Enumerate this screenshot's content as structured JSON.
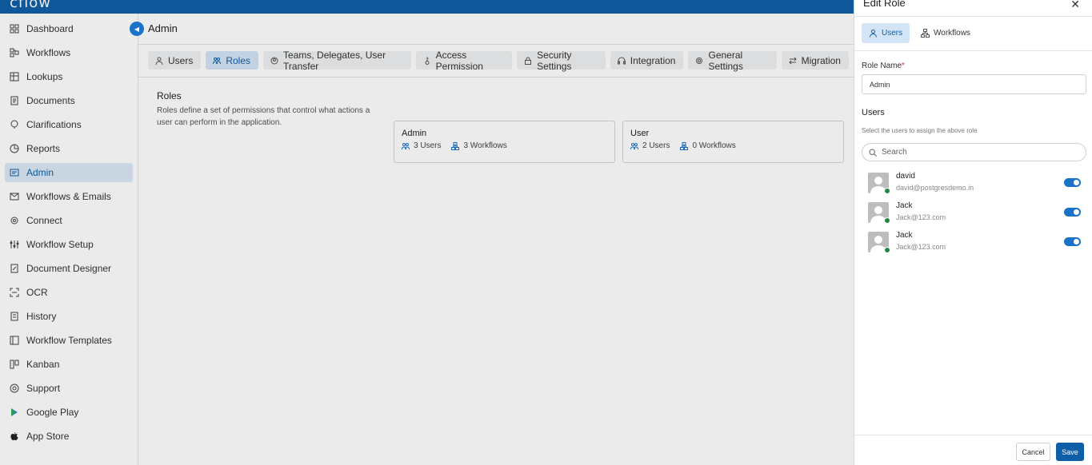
{
  "app": {
    "logo": "cflow"
  },
  "sidebar": {
    "items": [
      {
        "label": "Dashboard",
        "icon": "dashboard-icon"
      },
      {
        "label": "Workflows",
        "icon": "workflows-icon"
      },
      {
        "label": "Lookups",
        "icon": "lookups-icon"
      },
      {
        "label": "Documents",
        "icon": "documents-icon"
      },
      {
        "label": "Clarifications",
        "icon": "clarifications-icon"
      },
      {
        "label": "Reports",
        "icon": "reports-icon"
      },
      {
        "label": "Admin",
        "icon": "admin-icon",
        "active": true
      },
      {
        "label": "Workflows & Emails",
        "icon": "mail-icon"
      },
      {
        "label": "Connect",
        "icon": "connect-icon"
      },
      {
        "label": "Workflow Setup",
        "icon": "setup-icon"
      },
      {
        "label": "Document Designer",
        "icon": "designer-icon"
      },
      {
        "label": "OCR",
        "icon": "ocr-icon"
      },
      {
        "label": "History",
        "icon": "history-icon"
      },
      {
        "label": "Workflow Templates",
        "icon": "templates-icon"
      },
      {
        "label": "Kanban",
        "icon": "kanban-icon"
      },
      {
        "label": "Support",
        "icon": "support-icon"
      },
      {
        "label": "Google Play",
        "icon": "google-play-icon"
      },
      {
        "label": "App Store",
        "icon": "apple-icon"
      }
    ]
  },
  "main": {
    "title": "Admin",
    "tabs": [
      {
        "label": "Users",
        "icon": "user-icon"
      },
      {
        "label": "Roles",
        "icon": "roles-icon",
        "active": true
      },
      {
        "label": "Teams, Delegates, User Transfer",
        "icon": "teams-icon"
      },
      {
        "label": "Access Permission",
        "icon": "key-icon"
      },
      {
        "label": "Security Settings",
        "icon": "lock-icon"
      },
      {
        "label": "Integration",
        "icon": "integration-icon"
      },
      {
        "label": "General Settings",
        "icon": "gear-icon"
      },
      {
        "label": "Migration",
        "icon": "migration-icon"
      }
    ],
    "roles": {
      "title": "Roles",
      "description": "Roles define a set of permissions that control what actions a user can perform in the application.",
      "cards": [
        {
          "name": "Admin",
          "users": "3 Users",
          "workflows": "3 Workflows"
        },
        {
          "name": "User",
          "users": "2 Users",
          "workflows": "0 Workflows"
        }
      ]
    }
  },
  "panel": {
    "title": "Edit Role",
    "close": "✕",
    "tabs": [
      {
        "label": "Users",
        "active": true
      },
      {
        "label": "Workflows"
      }
    ],
    "role_name_label": "Role Name",
    "required_mark": "*",
    "role_name_value": "Admin",
    "users_heading": "Users",
    "users_subtext": "Select the users to assign the above role",
    "search_placeholder": "Search",
    "users": [
      {
        "name": "david",
        "email": "david@postgresdemo.in",
        "assigned": true,
        "online": true
      },
      {
        "name": "Jack",
        "email": "Jack@123.com",
        "assigned": true,
        "online": true
      },
      {
        "name": "Jack",
        "email": "Jack@123.com",
        "assigned": true,
        "online": true
      }
    ],
    "cancel_label": "Cancel",
    "save_label": "Save"
  },
  "colors": {
    "brand": "#0f5fa8",
    "active_bg": "#d3e4f6",
    "online": "#1e8a3f"
  }
}
